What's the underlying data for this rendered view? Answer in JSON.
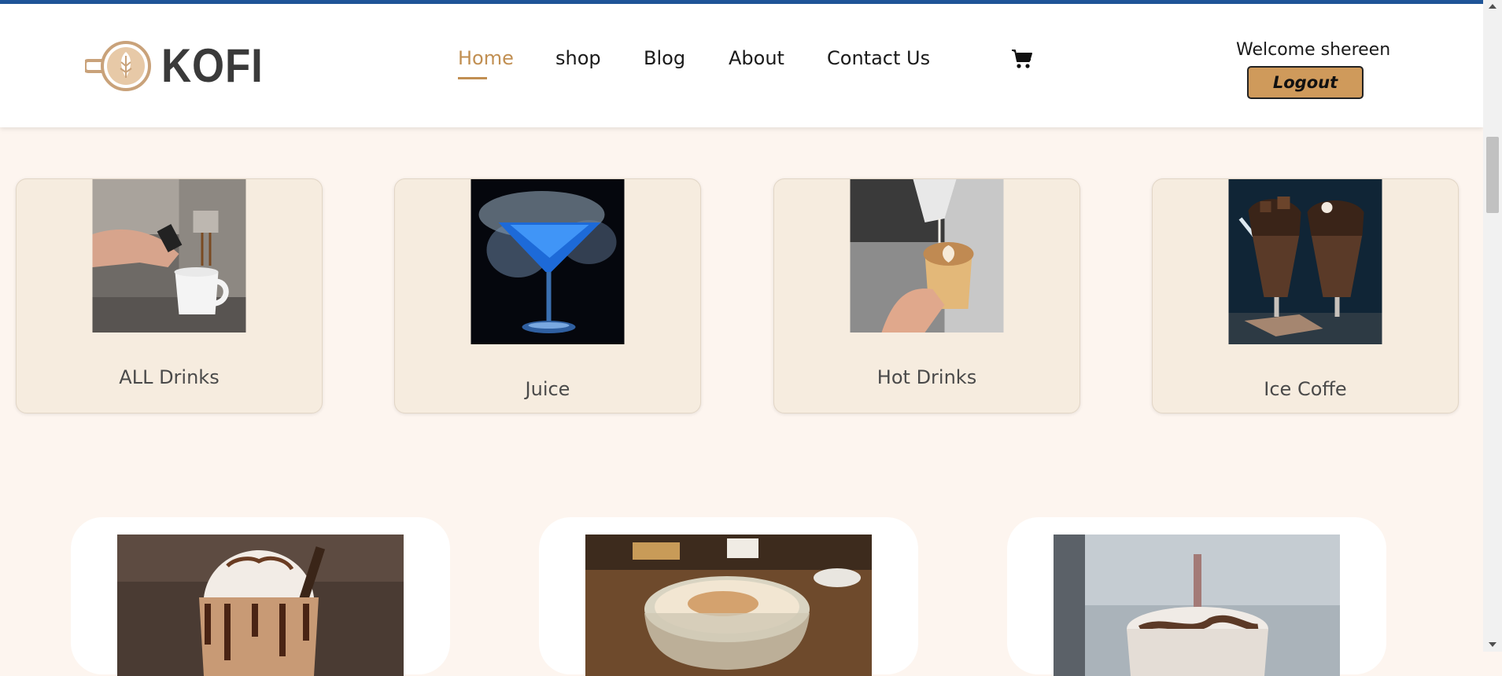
{
  "brand": {
    "name": "KOFI"
  },
  "nav": {
    "items": [
      {
        "label": "Home",
        "active": true
      },
      {
        "label": "shop",
        "active": false
      },
      {
        "label": "Blog",
        "active": false
      },
      {
        "label": "About",
        "active": false
      },
      {
        "label": "Contact Us",
        "active": false
      }
    ],
    "cart_icon": "shopping-cart-icon"
  },
  "user": {
    "welcome": "Welcome shereen",
    "logout_label": "Logout"
  },
  "categories": [
    {
      "label": "ALL Drinks",
      "image": "espresso-machine-pouring-photo"
    },
    {
      "label": "Juice",
      "image": "smoky-blue-cocktail-photo"
    },
    {
      "label": "Hot Drinks",
      "image": "latte-art-cup-photo"
    },
    {
      "label": "Ice Coffe",
      "image": "chocolate-milkshake-photo"
    }
  ],
  "products": [
    {
      "image": "chocolate-frappe-photo"
    },
    {
      "image": "cappuccino-cup-photo"
    },
    {
      "image": "iced-mocha-photo"
    }
  ],
  "colors": {
    "accent": "#c18f52",
    "logout_bg": "#cf9a5b",
    "card_bg": "#f6ecdf",
    "page_bg": "#fdf5ef",
    "top_line": "#1f5599"
  }
}
